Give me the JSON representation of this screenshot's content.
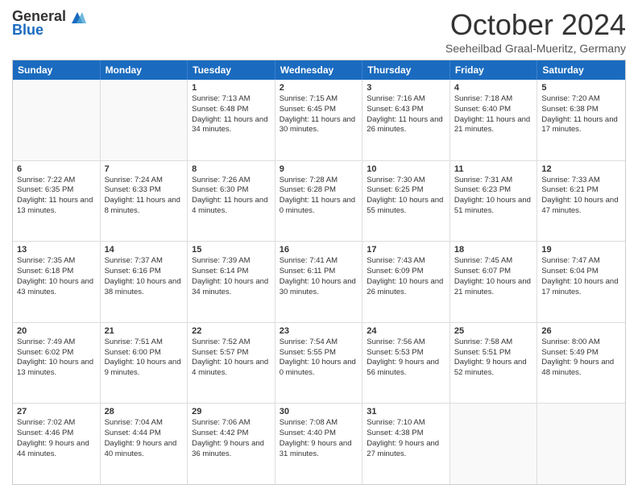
{
  "logo": {
    "general": "General",
    "blue": "Blue"
  },
  "title": "October 2024",
  "subtitle": "Seeheilbad Graal-Mueritz, Germany",
  "days": [
    "Sunday",
    "Monday",
    "Tuesday",
    "Wednesday",
    "Thursday",
    "Friday",
    "Saturday"
  ],
  "weeks": [
    [
      {
        "day": "",
        "text": ""
      },
      {
        "day": "",
        "text": ""
      },
      {
        "day": "1",
        "text": "Sunrise: 7:13 AM\nSunset: 6:48 PM\nDaylight: 11 hours and 34 minutes."
      },
      {
        "day": "2",
        "text": "Sunrise: 7:15 AM\nSunset: 6:45 PM\nDaylight: 11 hours and 30 minutes."
      },
      {
        "day": "3",
        "text": "Sunrise: 7:16 AM\nSunset: 6:43 PM\nDaylight: 11 hours and 26 minutes."
      },
      {
        "day": "4",
        "text": "Sunrise: 7:18 AM\nSunset: 6:40 PM\nDaylight: 11 hours and 21 minutes."
      },
      {
        "day": "5",
        "text": "Sunrise: 7:20 AM\nSunset: 6:38 PM\nDaylight: 11 hours and 17 minutes."
      }
    ],
    [
      {
        "day": "6",
        "text": "Sunrise: 7:22 AM\nSunset: 6:35 PM\nDaylight: 11 hours and 13 minutes."
      },
      {
        "day": "7",
        "text": "Sunrise: 7:24 AM\nSunset: 6:33 PM\nDaylight: 11 hours and 8 minutes."
      },
      {
        "day": "8",
        "text": "Sunrise: 7:26 AM\nSunset: 6:30 PM\nDaylight: 11 hours and 4 minutes."
      },
      {
        "day": "9",
        "text": "Sunrise: 7:28 AM\nSunset: 6:28 PM\nDaylight: 11 hours and 0 minutes."
      },
      {
        "day": "10",
        "text": "Sunrise: 7:30 AM\nSunset: 6:25 PM\nDaylight: 10 hours and 55 minutes."
      },
      {
        "day": "11",
        "text": "Sunrise: 7:31 AM\nSunset: 6:23 PM\nDaylight: 10 hours and 51 minutes."
      },
      {
        "day": "12",
        "text": "Sunrise: 7:33 AM\nSunset: 6:21 PM\nDaylight: 10 hours and 47 minutes."
      }
    ],
    [
      {
        "day": "13",
        "text": "Sunrise: 7:35 AM\nSunset: 6:18 PM\nDaylight: 10 hours and 43 minutes."
      },
      {
        "day": "14",
        "text": "Sunrise: 7:37 AM\nSunset: 6:16 PM\nDaylight: 10 hours and 38 minutes."
      },
      {
        "day": "15",
        "text": "Sunrise: 7:39 AM\nSunset: 6:14 PM\nDaylight: 10 hours and 34 minutes."
      },
      {
        "day": "16",
        "text": "Sunrise: 7:41 AM\nSunset: 6:11 PM\nDaylight: 10 hours and 30 minutes."
      },
      {
        "day": "17",
        "text": "Sunrise: 7:43 AM\nSunset: 6:09 PM\nDaylight: 10 hours and 26 minutes."
      },
      {
        "day": "18",
        "text": "Sunrise: 7:45 AM\nSunset: 6:07 PM\nDaylight: 10 hours and 21 minutes."
      },
      {
        "day": "19",
        "text": "Sunrise: 7:47 AM\nSunset: 6:04 PM\nDaylight: 10 hours and 17 minutes."
      }
    ],
    [
      {
        "day": "20",
        "text": "Sunrise: 7:49 AM\nSunset: 6:02 PM\nDaylight: 10 hours and 13 minutes."
      },
      {
        "day": "21",
        "text": "Sunrise: 7:51 AM\nSunset: 6:00 PM\nDaylight: 10 hours and 9 minutes."
      },
      {
        "day": "22",
        "text": "Sunrise: 7:52 AM\nSunset: 5:57 PM\nDaylight: 10 hours and 4 minutes."
      },
      {
        "day": "23",
        "text": "Sunrise: 7:54 AM\nSunset: 5:55 PM\nDaylight: 10 hours and 0 minutes."
      },
      {
        "day": "24",
        "text": "Sunrise: 7:56 AM\nSunset: 5:53 PM\nDaylight: 9 hours and 56 minutes."
      },
      {
        "day": "25",
        "text": "Sunrise: 7:58 AM\nSunset: 5:51 PM\nDaylight: 9 hours and 52 minutes."
      },
      {
        "day": "26",
        "text": "Sunrise: 8:00 AM\nSunset: 5:49 PM\nDaylight: 9 hours and 48 minutes."
      }
    ],
    [
      {
        "day": "27",
        "text": "Sunrise: 7:02 AM\nSunset: 4:46 PM\nDaylight: 9 hours and 44 minutes."
      },
      {
        "day": "28",
        "text": "Sunrise: 7:04 AM\nSunset: 4:44 PM\nDaylight: 9 hours and 40 minutes."
      },
      {
        "day": "29",
        "text": "Sunrise: 7:06 AM\nSunset: 4:42 PM\nDaylight: 9 hours and 36 minutes."
      },
      {
        "day": "30",
        "text": "Sunrise: 7:08 AM\nSunset: 4:40 PM\nDaylight: 9 hours and 31 minutes."
      },
      {
        "day": "31",
        "text": "Sunrise: 7:10 AM\nSunset: 4:38 PM\nDaylight: 9 hours and 27 minutes."
      },
      {
        "day": "",
        "text": ""
      },
      {
        "day": "",
        "text": ""
      }
    ]
  ]
}
